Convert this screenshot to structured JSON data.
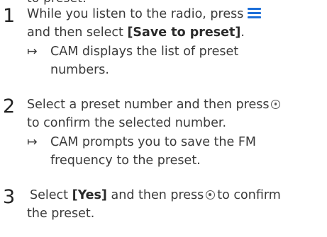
{
  "top_cut_text": "to preset:",
  "steps": [
    {
      "number": "1",
      "lines": [
        "While you listen to the radio, press",
        "and then select",
        "[Save to preset]",
        "."
      ],
      "result": [
        "CAM displays the list of preset",
        "numbers."
      ]
    },
    {
      "number": "2",
      "lines": [
        "Select a preset number and then press",
        "to confirm the selected number."
      ],
      "result": [
        "CAM prompts you to save the FM",
        "frequency to the preset."
      ]
    },
    {
      "number": "3",
      "lines": [
        "Select",
        "[Yes]",
        "and then press",
        "to confirm",
        "the preset."
      ]
    }
  ],
  "arrow_glyph": "↦",
  "icons": {
    "menu": "menu-icon",
    "ok": "ok-confirm-icon"
  },
  "colors": {
    "menu_icon": "#1d6fd9",
    "text": "#3a3a3a"
  }
}
